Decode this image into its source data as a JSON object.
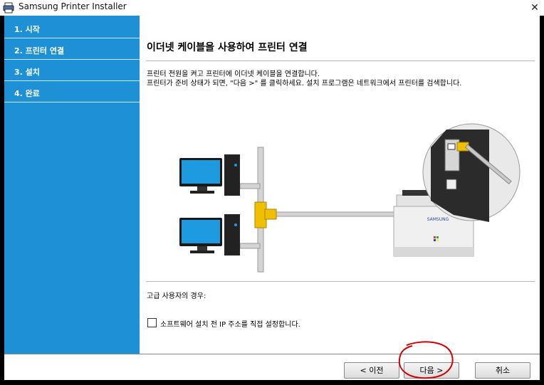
{
  "window": {
    "title": "Samsung Printer Installer"
  },
  "sidebar": {
    "items": [
      {
        "label": "1. 시작"
      },
      {
        "label": "2. 프린터 연결"
      },
      {
        "label": "3. 설치"
      },
      {
        "label": "4. 완료"
      }
    ]
  },
  "main": {
    "heading": "이더넷 케이블을 사용하여 프린터 연결",
    "desc_line1": "프린터 전원을 켜고 프린터에 이더넷 케이블을 연결합니다.",
    "desc_line2": "프린터가 준비 상태가 되면, \"다음 >\" 를 클릭하세요. 설치 프로그램은 네트워크에서 프린터를 검색합니다.",
    "illustration": {
      "printer_brand": "SAMSUNG"
    },
    "advanced_label": "고급 사용자의 경우:",
    "checkbox_label": "소프트웨어 설치 전 IP 주소를 직접 설정합니다.",
    "checkbox_checked": false
  },
  "buttons": {
    "back": "< 이전",
    "next": "다음 >",
    "cancel": "취소"
  },
  "colors": {
    "sidebar": "#1e90d6",
    "connector": "#f0c000",
    "annotation": "#d40000"
  }
}
